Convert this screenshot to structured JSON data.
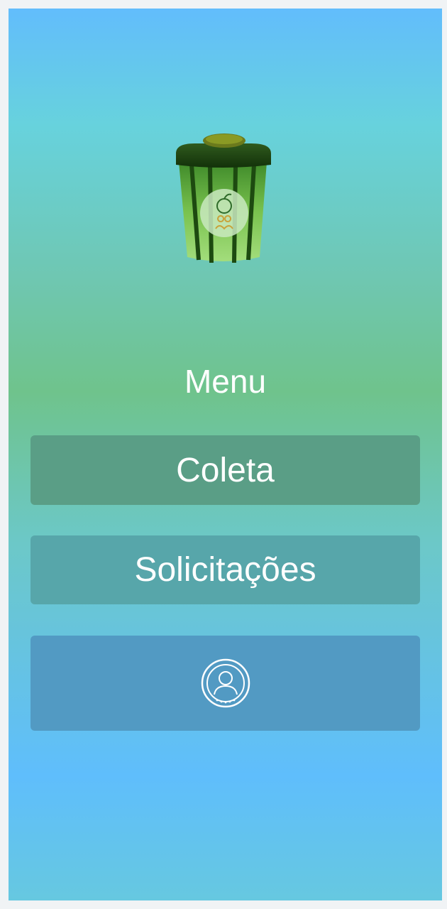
{
  "menu": {
    "title": "Menu",
    "buttons": [
      {
        "label": "Coleta"
      },
      {
        "label": "Solicitações"
      }
    ],
    "profile_button_icon": "user-profile-icon"
  },
  "logo": {
    "icon": "recycling-bin-logo"
  },
  "colors": {
    "gradient_top": "#62bdfc",
    "gradient_mid": "#6fc38c",
    "coleta_button": "#5a9e86",
    "solicitacoes_button": "#57a6aa",
    "profile_button": "#529ac3",
    "text": "#ffffff"
  }
}
